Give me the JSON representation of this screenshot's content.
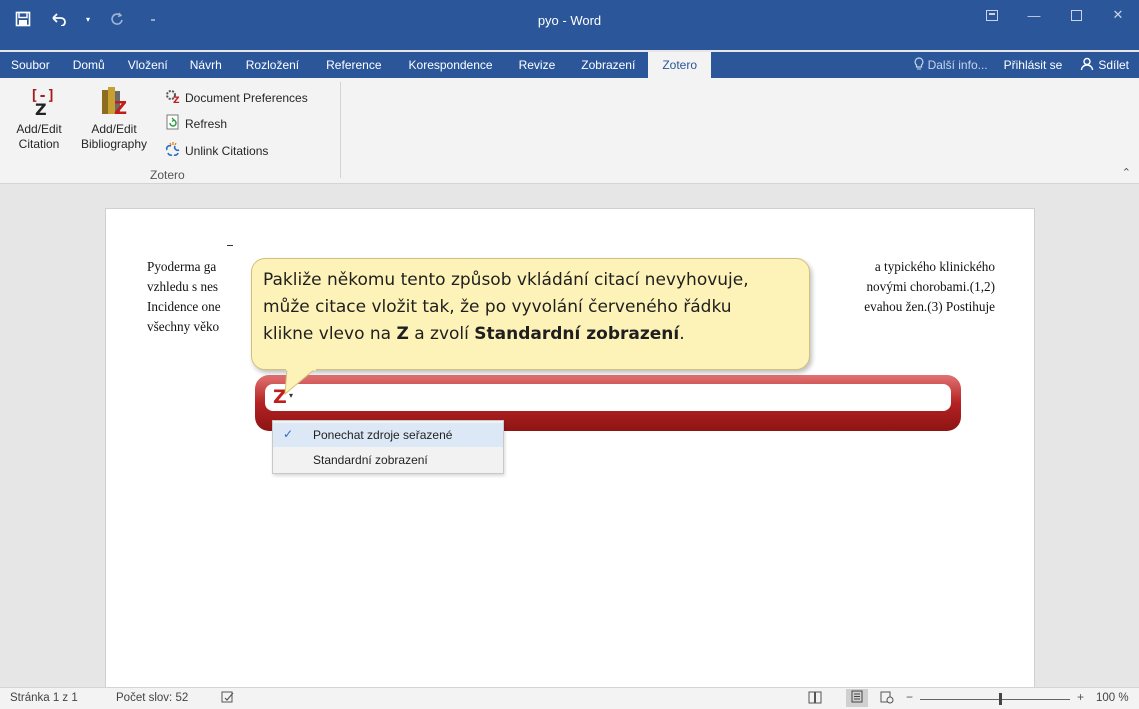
{
  "window": {
    "title": "pyo - Word"
  },
  "qat": {
    "save_icon": "save-icon",
    "undo_icon": "undo-icon",
    "redo_icon": "redo-icon",
    "customize_icon": "customize-icon"
  },
  "tabs": [
    {
      "label": "Soubor"
    },
    {
      "label": "Domů"
    },
    {
      "label": "Vložení"
    },
    {
      "label": "Návrh"
    },
    {
      "label": "Rozložení"
    },
    {
      "label": "Reference"
    },
    {
      "label": "Korespondence"
    },
    {
      "label": "Revize"
    },
    {
      "label": "Zobrazení"
    },
    {
      "label": "Zotero"
    }
  ],
  "tabs_right": {
    "tell_me": "Další info...",
    "sign_in": "Přihlásit se",
    "share": "Sdílet"
  },
  "ribbon": {
    "add_edit_citation": [
      "Add/Edit",
      "Citation"
    ],
    "add_edit_bibliography": [
      "Add/Edit",
      "Bibliography"
    ],
    "document_preferences": "Document Preferences",
    "refresh": "Refresh",
    "unlink_citations": "Unlink Citations",
    "group_label": "Zotero"
  },
  "document": {
    "paragraph": {
      "line1_left": "Pyoderma ga",
      "line1_right": "a typického klinického",
      "line2_left": "vzhledu s nes",
      "line2_right": "novými chorobami.(1,2)",
      "line3_left": "Incidence one",
      "line3_right": "evahou žen.(3) Postihuje",
      "line4_left": "všechny věko"
    }
  },
  "zotero_field": {
    "logo": "Z",
    "menu_items": [
      {
        "label": "Ponechat zdroje seřazené",
        "checked": true
      },
      {
        "label": "Standardní zobrazení",
        "checked": false
      }
    ]
  },
  "callout": {
    "line1": "Pakliže někomu tento způsob vkládání citací nevyhovuje,",
    "line2": "může citace vložit tak, že po vyvolání červeného řádku",
    "line3_a": "klikne vlevo na ",
    "line3_b": "Z",
    "line3_c": " a zvolí ",
    "line3_d": "Standardní zobrazení",
    "line3_e": "."
  },
  "statusbar": {
    "page": "Stránka 1 z 1",
    "words": "Počet slov: 52",
    "zoom": "100 %"
  },
  "colors": {
    "accent": "#2b579a",
    "callout_bg": "#fdf2b7",
    "zotero_red": "#b42222"
  }
}
